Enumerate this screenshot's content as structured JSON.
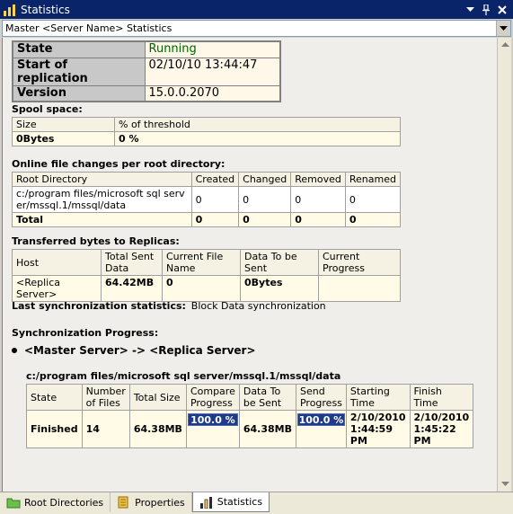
{
  "window": {
    "title": "Statistics",
    "controls": {
      "dropdown": "▾",
      "pin": "pin",
      "close": "×"
    }
  },
  "combo": {
    "value": "Master <Server Name> Statistics"
  },
  "status": {
    "rows": [
      {
        "key": "State",
        "value": "Running"
      },
      {
        "key": "Start of replication",
        "value": "02/10/10 13:44:47"
      },
      {
        "key": "Version",
        "value": "15.0.0.2070"
      }
    ]
  },
  "spool": {
    "title": "Spool space:",
    "headers": [
      "Size",
      "% of threshold"
    ],
    "values": [
      "0Bytes",
      "0 %"
    ]
  },
  "online_changes": {
    "title": "Online file changes per root directory:",
    "headers": [
      "Root Directory",
      "Created",
      "Changed",
      "Removed",
      "Renamed"
    ],
    "row": [
      "c:/program files/microsoft sql server/mssql.1/mssql/data",
      "0",
      "0",
      "0",
      "0"
    ],
    "total": [
      "Total",
      "0",
      "0",
      "0",
      "0"
    ]
  },
  "transferred": {
    "title": "Transferred bytes to Replicas:",
    "headers": [
      "Host",
      "Total Sent Data",
      "Current File Name",
      "Data To be Sent",
      "Current Progress"
    ],
    "values": [
      "<Replica Server>",
      "64.42MB",
      "0",
      "0Bytes",
      ""
    ]
  },
  "last_sync": {
    "label": "Last synchronization statistics:",
    "value": "Block Data synchronization"
  },
  "sync_progress": {
    "title": "Synchronization Progress:",
    "pair": "<Master Server> -> <Replica Server>",
    "path": "c:/program files/microsoft sql server/mssql.1/mssql/data",
    "headers": [
      "State",
      "Number of Files",
      "Total Size",
      "Compare Progress",
      "Data To be Sent",
      "Send Progress",
      "Starting Time",
      "Finish Time"
    ],
    "values": {
      "state": "Finished",
      "files": "14",
      "total_size": "64.38MB",
      "compare_progress": "100.0 %",
      "compare_fraction": 1.0,
      "data_to_be_sent": "64.38MB",
      "send_progress": "100.0 %",
      "send_fraction": 1.0,
      "starting_time": "2/10/2010 1:44:59 PM",
      "finish_time": "2/10/2010 1:45:22 PM"
    }
  },
  "tabs": [
    {
      "label": "Root Directories",
      "icon": "folder-icon",
      "active": false
    },
    {
      "label": "Properties",
      "icon": "properties-icon",
      "active": false
    },
    {
      "label": "Statistics",
      "icon": "statistics-icon",
      "active": true
    }
  ],
  "colors": {
    "title_bar": "#0a246a",
    "running": "#006400",
    "progress_bar": "#1f3a8a"
  }
}
